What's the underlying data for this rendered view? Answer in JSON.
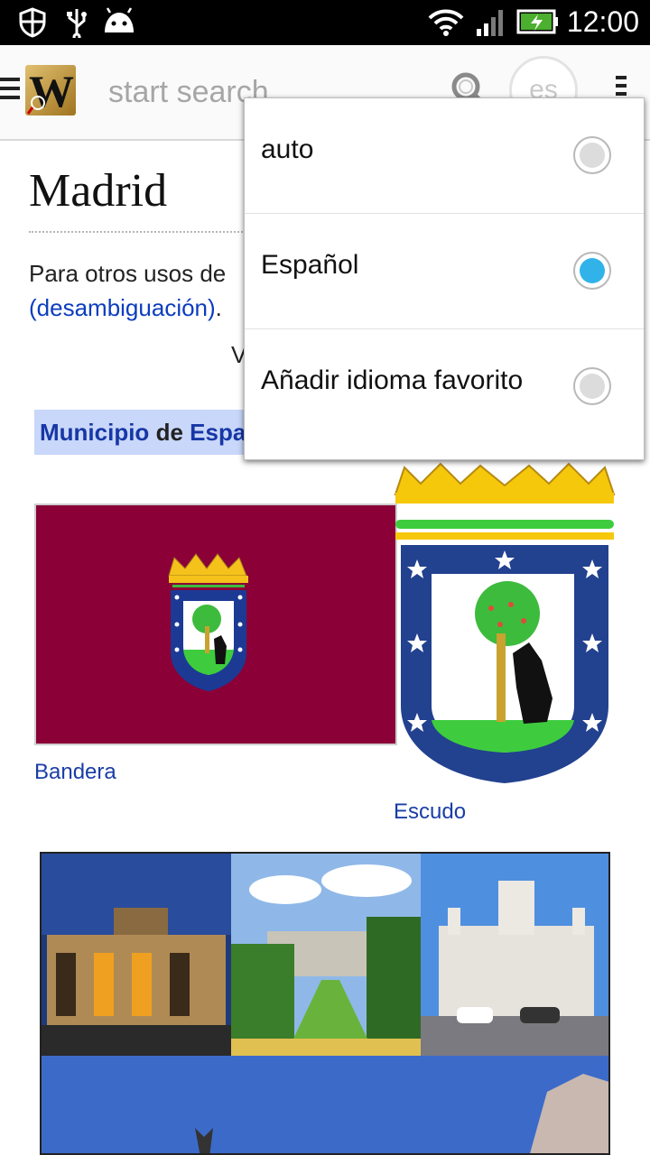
{
  "status_bar": {
    "time": "12:00",
    "icons": [
      "shield-icon",
      "usb-icon",
      "android-icon",
      "wifi-icon",
      "signal-icon",
      "battery-charging-icon"
    ]
  },
  "toolbar": {
    "search_placeholder": "start search",
    "lang_label": "es",
    "icons": [
      "menu-icon",
      "app-logo-icon",
      "search-icon",
      "overflow-menu-icon"
    ]
  },
  "article": {
    "title": "Madrid",
    "hatnote_prefix": "Para otros usos de",
    "hatnote_link": "(desambiguación)",
    "hatnote_suffix": ".",
    "ver_fragment": "V",
    "municipio_link": "Municipio",
    "municipio_de": "de",
    "municipio_country": "Espa",
    "flag_caption": "Bandera",
    "coat_caption": "Escudo"
  },
  "language_menu": {
    "items": [
      {
        "label": "auto",
        "selected": false
      },
      {
        "label": "Español",
        "selected": true
      },
      {
        "label": "Añadir idioma favorito",
        "selected": false
      }
    ]
  },
  "colors": {
    "link": "#0b3dbf",
    "flag": "#8a0037",
    "radio_selected": "#31b3ea",
    "infobox_header": "#c8d7fa"
  }
}
